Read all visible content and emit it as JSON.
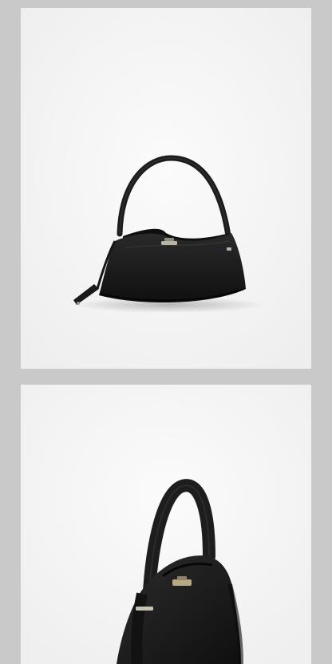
{
  "images": [
    {
      "subject": "black-leather-handbag",
      "view": "front",
      "colors": {
        "leather": "#1b1b1b",
        "hardware": "#b9b3a6",
        "background": "#f6f6f6"
      }
    },
    {
      "subject": "black-leather-handbag",
      "view": "angled-close-up",
      "colors": {
        "leather": "#1d1d1d",
        "hardware": "#b8a883",
        "background": "#f6f6f6"
      }
    }
  ],
  "page_background": "#c9c9c9"
}
